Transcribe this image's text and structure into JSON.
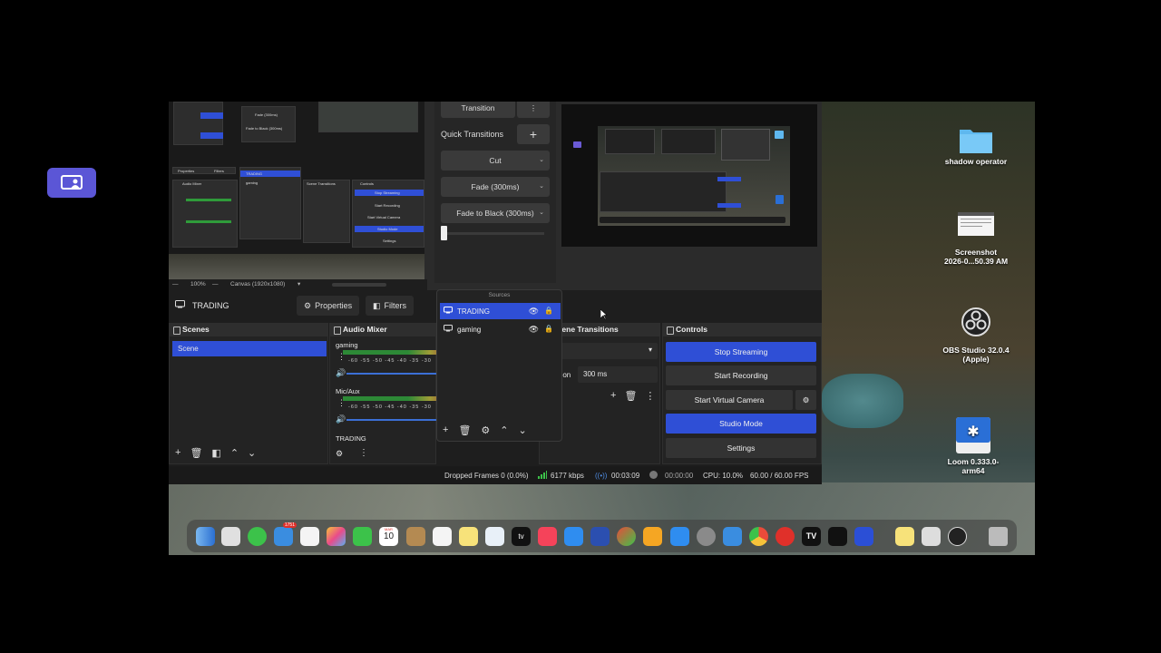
{
  "obs": {
    "preview": {
      "transition_label": "Transition",
      "quick_transitions_label": "Quick Transitions",
      "quick_buttons": [
        "Cut",
        "Fade (300ms)",
        "Fade to Black (300ms)"
      ],
      "zoom": "100%",
      "canvas": "Canvas (1920x1080)",
      "nested": {
        "fade_label": "Fade (300ms)",
        "fade_black_label": "Fade to Black (300ms)",
        "trading": "TRADING",
        "gaming": "gaming",
        "properties": "Properties",
        "filters": "Filters",
        "audio_mixer": "Audio Mixer",
        "scene_transitions": "Scene Transitions",
        "controls": "Controls",
        "stop_streaming": "Stop Streaming",
        "start_recording": "Start Recording",
        "start_virtual_camera": "Start Virtual Camera",
        "studio_mode": "Studio Mode",
        "settings": "Settings"
      }
    },
    "scene_row": {
      "current_scene": "TRADING",
      "properties": "Properties",
      "filters": "Filters"
    },
    "scenes": {
      "title": "Scenes",
      "items": [
        "Scene"
      ]
    },
    "audio_mixer": {
      "title": "Audio Mixer",
      "channels": [
        {
          "name": "gaming",
          "scale": "-60 -55 -50 -45 -40 -35 -30"
        },
        {
          "name": "Mic/Aux",
          "scale": "-60 -55 -50 -45 -40 -35 -30"
        },
        {
          "name": "TRADING",
          "scale": ""
        }
      ]
    },
    "scene_transitions": {
      "title": "Scene Transitions",
      "duration_label": "Duration",
      "duration_value": "300 ms"
    },
    "controls": {
      "title": "Controls",
      "stop_streaming": "Stop Streaming",
      "start_recording": "Start Recording",
      "start_virtual_camera": "Start Virtual Camera",
      "studio_mode": "Studio Mode",
      "settings": "Settings"
    },
    "sources": {
      "title": "Sources",
      "items": [
        {
          "name": "TRADING",
          "selected": true
        },
        {
          "name": "gaming",
          "selected": false
        }
      ]
    },
    "status": {
      "dropped_frames": "Dropped Frames 0 (0.0%)",
      "bitrate": "6177 kbps",
      "stream_time": "00:03:09",
      "record_time": "00:00:00",
      "cpu": "CPU: 10.0%",
      "fps": "60.00 / 60.00 FPS"
    },
    "accent_color": "#2f4fd6"
  },
  "desktop_icons": [
    {
      "label": "shadow operator",
      "icon": "folder-icon"
    },
    {
      "label": "Screenshot",
      "label2": "2026-0...50.39 AM",
      "icon": "screenshot-file-icon"
    },
    {
      "label": "OBS Studio 32.0.4",
      "label2": "(Apple)",
      "icon": "obs-app-icon"
    },
    {
      "label": "Loom 0.333.0-",
      "label2": "arm64",
      "icon": "loom-disk-icon"
    }
  ],
  "dock": {
    "calendar_month": "MAR",
    "calendar_day": "10",
    "mail_badge": "1751"
  }
}
